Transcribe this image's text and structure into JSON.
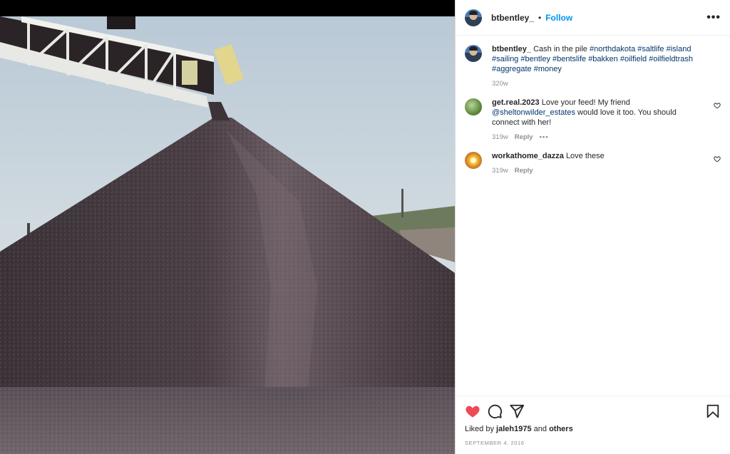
{
  "post": {
    "owner": "btbentley_",
    "dot": "•",
    "follow_label": "Follow",
    "more_icon": "more-horizontal-icon",
    "caption": {
      "username": "btbentley_",
      "text": "Cash in the pile",
      "hashtags": [
        "#northdakota",
        "#saltlife",
        "#island",
        "#sailing",
        "#bentley",
        "#bentslife",
        "#bakken",
        "#oilfield",
        "#oilfieldtrash",
        "#aggregate",
        "#money"
      ],
      "time": "320w"
    },
    "comments": [
      {
        "username": "get.real.2023",
        "text_before": "Love your feed! My friend",
        "mention": "@sheltonwilder_estates",
        "text_after": "would love it too. You should connect with her!",
        "time": "319w",
        "reply_label": "Reply",
        "options_label": "•••"
      },
      {
        "username": "workathome_dazza",
        "text": "Love these",
        "time": "319w",
        "reply_label": "Reply"
      }
    ],
    "likes": {
      "prefix": "Liked by",
      "user": "jaleh1975",
      "middle": "and",
      "others": "others"
    },
    "date": "SEPTEMBER 4, 2016"
  },
  "colors": {
    "like_active": "#ed4956",
    "link": "#00376b",
    "follow": "#0095f6"
  },
  "icons": {
    "like": "heart-filled-icon",
    "comment": "comment-bubble-icon",
    "share": "paper-plane-icon",
    "save": "bookmark-icon",
    "comment_like": "heart-outline-icon"
  }
}
